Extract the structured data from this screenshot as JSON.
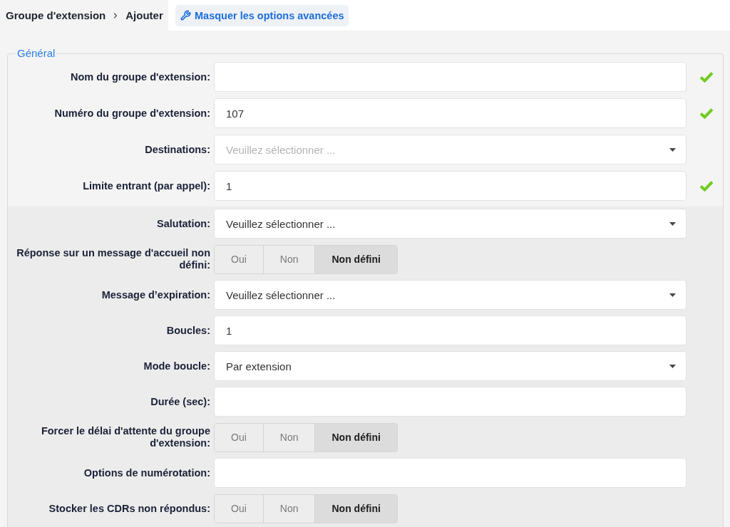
{
  "breadcrumb": [
    "Groupe d'extension",
    "Ajouter"
  ],
  "advanced_toggle_button": {
    "label": "Masquer les options avancées"
  },
  "section": {
    "legend": "Général",
    "fields": [
      {
        "kind": "text",
        "label": "Nom du groupe d'extension:",
        "valid": true
      },
      {
        "kind": "text",
        "label": "Numéro du groupe d'extension:",
        "value": "107",
        "valid": true
      },
      {
        "kind": "select",
        "label": "Destinations:",
        "placeholder": "Veuillez sélectionner ...",
        "valid": false
      },
      {
        "kind": "text",
        "label": "Limite entrant (par appel):",
        "value": "1",
        "valid": true
      }
    ],
    "advanced_fields": [
      {
        "kind": "select",
        "label": "Salutation:",
        "value": "Veuillez sélectionner ..."
      },
      {
        "kind": "toggle",
        "label": "Réponse sur un message d'accueil non défini:",
        "options": [
          {
            "label": "Oui",
            "selected": false
          },
          {
            "label": "Non",
            "selected": false
          },
          {
            "label": "Non défini",
            "selected": true
          }
        ]
      },
      {
        "kind": "select",
        "label": "Message d’expiration:",
        "value": "Veuillez sélectionner ..."
      },
      {
        "kind": "text",
        "label": "Boucles:",
        "value": "1"
      },
      {
        "kind": "select",
        "label": "Mode boucle:",
        "value": "Par extension"
      },
      {
        "kind": "text",
        "label": "Durée (sec):"
      },
      {
        "kind": "toggle",
        "label": "Forcer le délai d'attente du groupe d'extension:",
        "options": [
          {
            "label": "Oui",
            "selected": false
          },
          {
            "label": "Non",
            "selected": false
          },
          {
            "label": "Non défini",
            "selected": true
          }
        ]
      },
      {
        "kind": "text",
        "label": "Options de numérotation:"
      },
      {
        "kind": "toggle",
        "label": "Stocker les CDRs non répondus:",
        "options": [
          {
            "label": "Oui",
            "selected": false
          },
          {
            "label": "Non",
            "selected": false
          },
          {
            "label": "Non défini",
            "selected": true
          }
        ]
      }
    ]
  }
}
